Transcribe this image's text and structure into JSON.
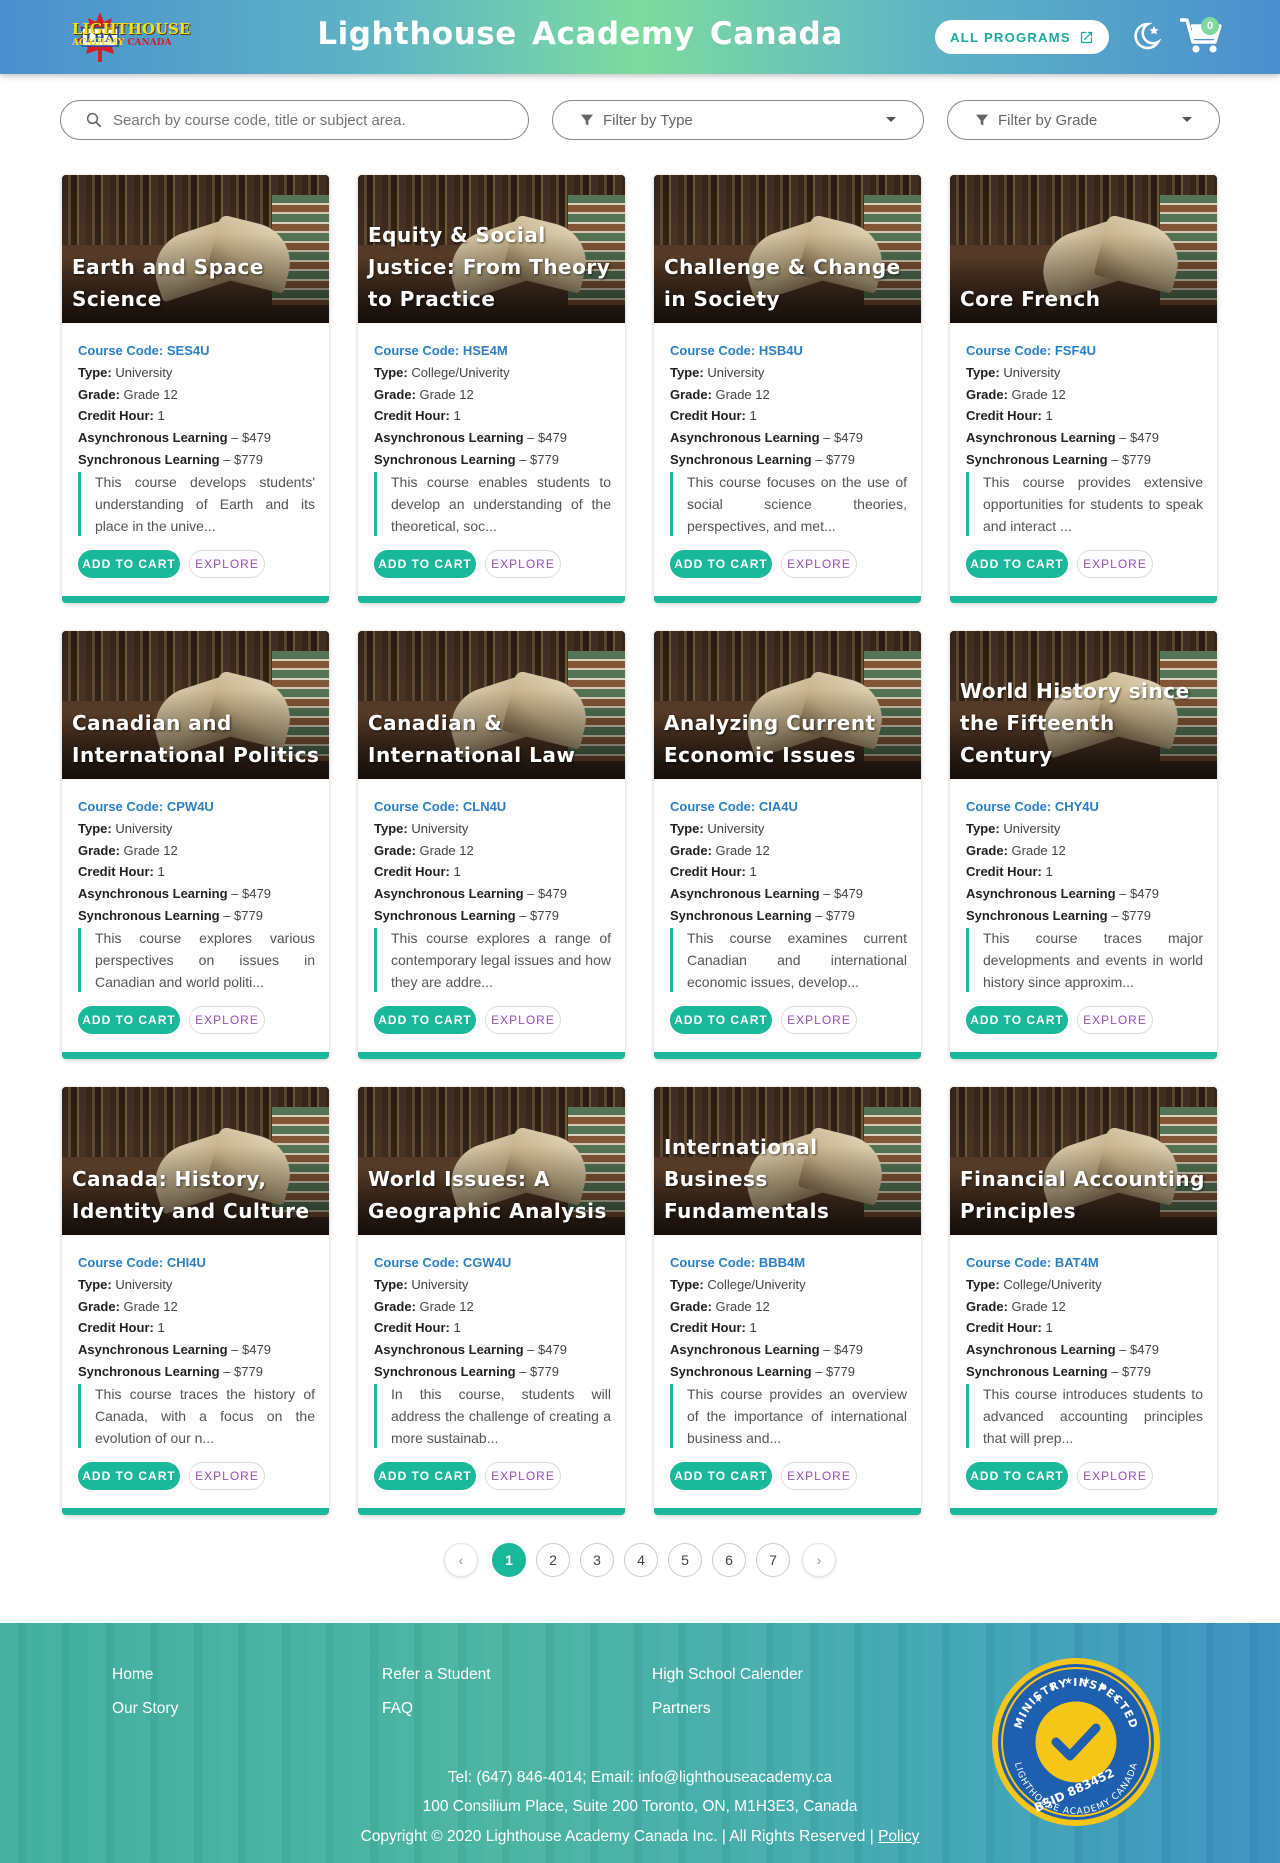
{
  "header": {
    "logo_main": "LIGHTHOUSE",
    "logo_sub1": "ACADEMY",
    "logo_sub2": "CANADA",
    "logo_badge": "LHA",
    "title": "Lighthouse Academy Canada",
    "all_programs_label": "ALL PROGRAMS",
    "cart_count": "0"
  },
  "filters": {
    "search_placeholder": "Search by course code, title or subject area.",
    "type_label": "Filter by Type",
    "grade_label": "Filter by Grade"
  },
  "labels": {
    "code": "Course Code:",
    "type": "Type:",
    "grade": "Grade:",
    "credit": "Credit Hour:",
    "async": "Asynchronous Learning",
    "sync": "Synchronous Learning",
    "add_to_cart": "ADD TO CART",
    "explore": "EXPLORE"
  },
  "courses": [
    {
      "title": "Earth and Space Science",
      "code": "SES4U",
      "type": "University",
      "grade": "Grade 12",
      "credit": "1",
      "async_price": "– $479",
      "sync_price": "– $779",
      "desc": "This course develops students' understanding of Earth and its place in the unive..."
    },
    {
      "title": "Equity & Social Justice: From Theory to Practice",
      "code": "HSE4M",
      "type": "College/Univerity",
      "grade": "Grade 12",
      "credit": "1",
      "async_price": "– $479",
      "sync_price": "– $779",
      "desc": "This course enables students to develop an understanding of the theoretical, soc..."
    },
    {
      "title": "Challenge & Change in Society",
      "code": "HSB4U",
      "type": "University",
      "grade": "Grade 12",
      "credit": "1",
      "async_price": "– $479",
      "sync_price": "– $779",
      "desc": "This course focuses on the use of social science theories, perspectives, and met..."
    },
    {
      "title": "Core French",
      "code": "FSF4U",
      "type": "University",
      "grade": "Grade 12",
      "credit": "1",
      "async_price": "– $479",
      "sync_price": "– $779",
      "desc": "This course provides extensive opportunities for students to speak and interact ..."
    },
    {
      "title": "Canadian and International Politics",
      "code": "CPW4U",
      "type": "University",
      "grade": "Grade 12",
      "credit": "1",
      "async_price": "– $479",
      "sync_price": "– $779",
      "desc": "This course explores various perspectives on issues in Canadian and world politi..."
    },
    {
      "title": "Canadian & International Law",
      "code": "CLN4U",
      "type": "University",
      "grade": "Grade 12",
      "credit": "1",
      "async_price": "– $479",
      "sync_price": "– $779",
      "desc": "This course explores a range of contemporary legal issues and how they are addre..."
    },
    {
      "title": "Analyzing Current Economic Issues",
      "code": "CIA4U",
      "type": "University",
      "grade": "Grade 12",
      "credit": "1",
      "async_price": "– $479",
      "sync_price": "– $779",
      "desc": "This course examines current Canadian and international economic issues, develop..."
    },
    {
      "title": "World History since the Fifteenth Century",
      "code": "CHY4U",
      "type": "University",
      "grade": "Grade 12",
      "credit": "1",
      "async_price": "– $479",
      "sync_price": "– $779",
      "desc": "This course traces major developments and events in world history since approxim..."
    },
    {
      "title": "Canada: History, Identity and Culture",
      "code": "CHI4U",
      "type": "University",
      "grade": "Grade 12",
      "credit": "1",
      "async_price": "– $479",
      "sync_price": "– $779",
      "desc": "This course traces the history of Canada, with a focus on the evolution of our n..."
    },
    {
      "title": "World Issues: A Geographic Analysis",
      "code": "CGW4U",
      "type": "University",
      "grade": "Grade 12",
      "credit": "1",
      "async_price": "– $479",
      "sync_price": "– $779",
      "desc": "In this course, students will address the challenge of creating a more sustainab..."
    },
    {
      "title": "International Business Fundamentals",
      "code": "BBB4M",
      "type": "College/Univerity",
      "grade": "Grade 12",
      "credit": "1",
      "async_price": "– $479",
      "sync_price": "– $779",
      "desc": "This course provides an overview of the importance of international business and..."
    },
    {
      "title": "Financial Accounting Principles",
      "code": "BAT4M",
      "type": "College/Univerity",
      "grade": "Grade 12",
      "credit": "1",
      "async_price": "– $479",
      "sync_price": "– $779",
      "desc": "This course introduces students to advanced accounting principles that will prep..."
    }
  ],
  "pagination": {
    "prev": "‹",
    "next": "›",
    "pages": [
      "1",
      "2",
      "3",
      "4",
      "5",
      "6",
      "7"
    ],
    "current": "1"
  },
  "footer": {
    "links": [
      "Home",
      "Our Story",
      "Refer a Student",
      "FAQ",
      "High School Calender",
      "Partners"
    ],
    "contact": "Tel: (647) 846-4014; Email: info@lighthouseacademy.ca",
    "address": "100 Consilium Place, Suite 200 Toronto, ON, M1H3E3, Canada",
    "copyright": "Copyright © 2020 Lighthouse Academy Canada Inc. | All Rights Reserved |",
    "policy": "Policy",
    "badge_top": "MINISTRY INSPECTED",
    "badge_id": "BSID 883452",
    "badge_bottom": "LIGHTHOUSE ACADEMY CANADA"
  },
  "colors": {
    "accent": "#1ab89a",
    "code_blue": "#2d7fc4",
    "explore_purple": "#9a4fc0",
    "badge_yellow": "#f5c518"
  }
}
